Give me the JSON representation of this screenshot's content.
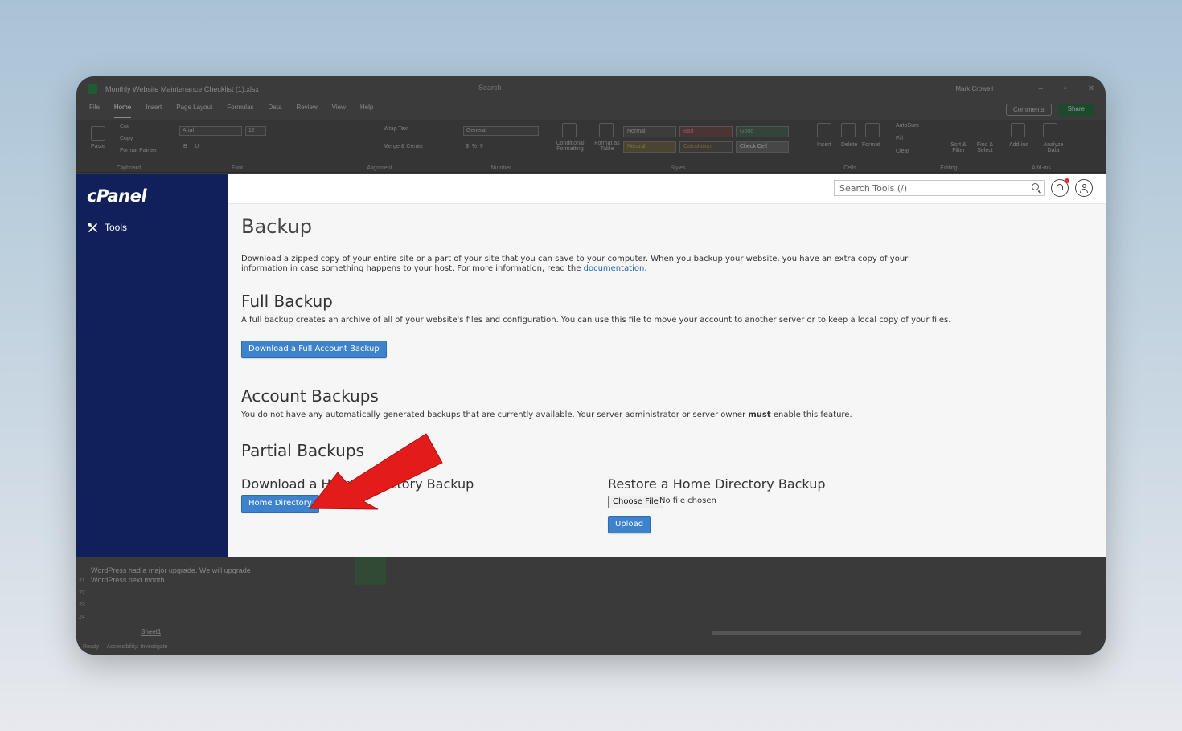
{
  "excel": {
    "file_title": "Monthly Website Maintenance Checklist (1).xlsx",
    "search": "Search",
    "user": "Mark Crowell",
    "menu": [
      "File",
      "Home",
      "Insert",
      "Page Layout",
      "Formulas",
      "Data",
      "Review",
      "View",
      "Help"
    ],
    "comments": "Comments",
    "share": "Share",
    "ribbon": {
      "paste": "Paste",
      "cut": "Cut",
      "copy": "Copy",
      "format_painter": "Format Painter",
      "clipboard": "Clipboard",
      "font_name": "Arial",
      "font_size": "12",
      "font": "Font",
      "wrap_text": "Wrap Text",
      "merge_center": "Merge & Center",
      "alignment": "Alignment",
      "number_format": "General",
      "number": "Number",
      "conditional_formatting": "Conditional Formatting",
      "format_as_table": "Format as Table",
      "style_normal": "Normal",
      "style_bad": "Bad",
      "style_good": "Good",
      "style_neutral": "Neutral",
      "style_calculation": "Calculation",
      "style_check_cell": "Check Cell",
      "styles": "Styles",
      "insert": "Insert",
      "delete": "Delete",
      "format": "Format",
      "cells": "Cells",
      "autosum": "AutoSum",
      "fill": "Fill",
      "clear": "Clear",
      "sort_filter": "Sort & Filter",
      "find_select": "Find & Select",
      "editing": "Editing",
      "add_ins": "Add-ins",
      "analyze_data": "Analyze Data",
      "add_ins_group": "Add-ins"
    },
    "cell_note": "WordPress had a major upgrade. We will upgrade WordPress next month",
    "row_numbers": [
      "21",
      "22",
      "23",
      "24"
    ],
    "sheet_tab": "Sheet1",
    "status_ready": "Ready",
    "status_accessibility": "Accessibility: Investigate"
  },
  "cpanel": {
    "brand": "cPanel",
    "nav_tools": "Tools",
    "search_placeholder": "Search Tools (/)",
    "page_title": "Backup",
    "intro_text": "Download a zipped copy of your entire site or a part of your site that you can save to your computer. When you backup your website, you have an extra copy of your information in case something happens to your host. For more information, read the",
    "intro_link": "documentation",
    "full_backup": {
      "title": "Full Backup",
      "description": "A full backup creates an archive of all of your website's files and configuration. You can use this file to move your account to another server or to keep a local copy of your files.",
      "button": "Download a Full Account Backup"
    },
    "account_backups": {
      "title": "Account Backups",
      "description_pre": "You do not have any automatically generated backups that are currently available. Your server administrator or server owner ",
      "description_bold": "must",
      "description_post": " enable this feature."
    },
    "partial_backups": {
      "title": "Partial Backups",
      "download_title": "Download a Home Directory Backup",
      "download_button": "Home Directory",
      "restore_title": "Restore a Home Directory Backup",
      "choose_file": "Choose File",
      "no_file": "No file chosen",
      "upload": "Upload"
    }
  },
  "colors": {
    "sidebar": "#11205a",
    "button": "#3c82cc",
    "arrow": "#e31b1b"
  }
}
